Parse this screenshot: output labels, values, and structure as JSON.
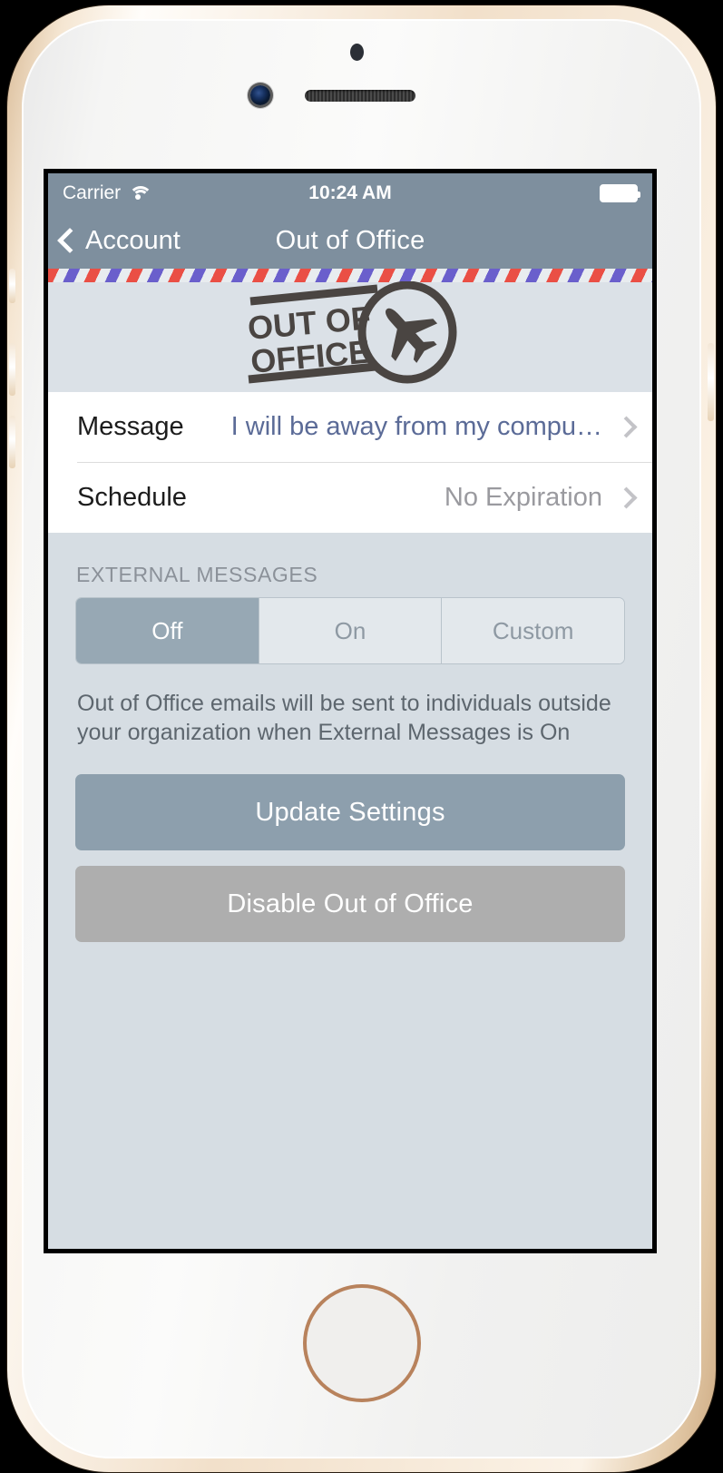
{
  "device": {
    "front_camera": "front-camera",
    "proximity_sensor": "proximity-sensor",
    "earpiece": "earpiece-speaker",
    "home_button": "home-button"
  },
  "status_bar": {
    "carrier": "Carrier",
    "wifi_icon": "wifi-icon",
    "time": "10:24 AM",
    "battery_icon": "battery-full-icon"
  },
  "nav_bar": {
    "back_icon": "chevron-left-icon",
    "back_label": "Account",
    "title": "Out of Office"
  },
  "banner": {
    "stamp_line1": "OUT OF",
    "stamp_line2": "OFFICE",
    "airplane_icon": "airplane-icon",
    "stripe_colors": [
      "#ea4f45",
      "#e8ecef",
      "#6a5fcc"
    ],
    "background": "#dbe1e7"
  },
  "settings": {
    "rows": [
      {
        "label": "Message",
        "value": "I will be away from my compu…",
        "style": "accent",
        "disclosure": "chevron-right-icon"
      },
      {
        "label": "Schedule",
        "value": "No Expiration",
        "style": "muted",
        "disclosure": "chevron-right-icon"
      }
    ]
  },
  "external_messages": {
    "header": "EXTERNAL MESSAGES",
    "segments": [
      {
        "label": "Off",
        "selected": true
      },
      {
        "label": "On",
        "selected": false
      },
      {
        "label": "Custom",
        "selected": false
      }
    ],
    "selected": "Off",
    "description": "Out of Office emails will be sent to individuals outside your organization when External Messages is On"
  },
  "actions": {
    "update_label": "Update Settings",
    "disable_label": "Disable Out of Office"
  },
  "colors": {
    "nav_bar": "#7e8f9e",
    "screen_background": "#d6dde3",
    "row_background": "#ffffff",
    "accent_text": "#5b6b97",
    "muted_text": "#9a9a9f",
    "segment_selected": "#97a8b4",
    "primary_button": "#8d9fad",
    "secondary_button": "#aeaeae"
  }
}
